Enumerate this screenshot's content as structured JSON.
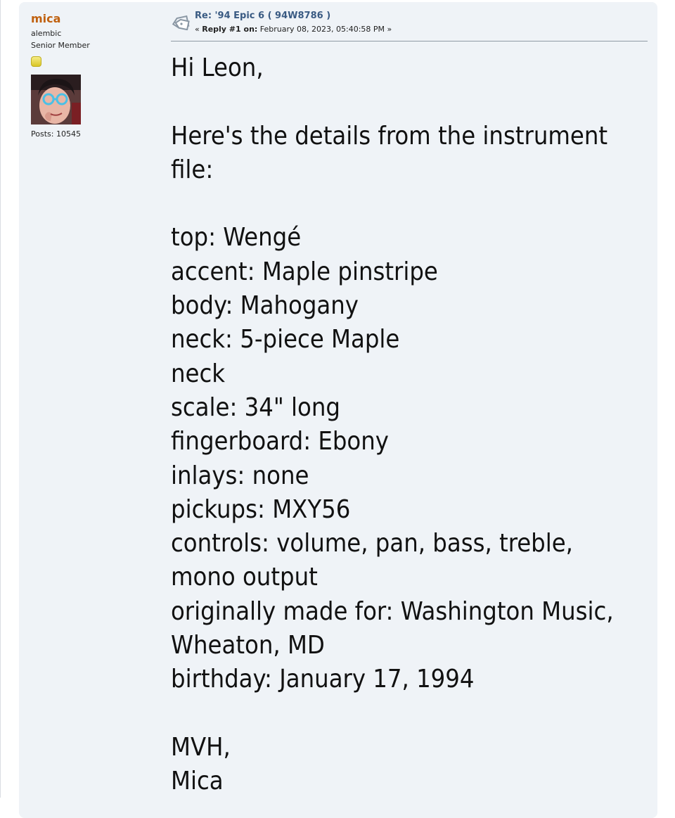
{
  "poster": {
    "name": "mica",
    "title_line1": "alembic",
    "title_line2": "Senior Member",
    "posts": "Posts: 10545"
  },
  "post": {
    "subject": "Re: '94 Epic 6 ( 94W8786 )",
    "meta_prefix": "« ",
    "reply_label": "Reply #1 on:",
    "date": " February 08, 2023, 05:40:58 PM »",
    "body_lines": [
      "Hi Leon,",
      "",
      "Here's the details from the instrument",
      "file:",
      "",
      "top: Wengé",
      "accent: Maple pinstripe",
      "body: Mahogany",
      "neck: 5-piece Maple",
      "neck",
      "scale: 34\" long",
      "fingerboard: Ebony",
      "inlays: none",
      "pickups: MXY56",
      "controls: volume, pan, bass, treble,",
      "mono output",
      "originally made for: Washington Music,",
      "Wheaton, MD",
      "birthday: January 17, 1994",
      "",
      "MVH,",
      "Mica"
    ]
  },
  "colors": {
    "poster_name": "#c0610f",
    "subject": "#3a5b83",
    "card_background": "#eff3f7"
  },
  "icons": {
    "topic": "topic-tag-icon",
    "rank": "rank-star-icon"
  }
}
